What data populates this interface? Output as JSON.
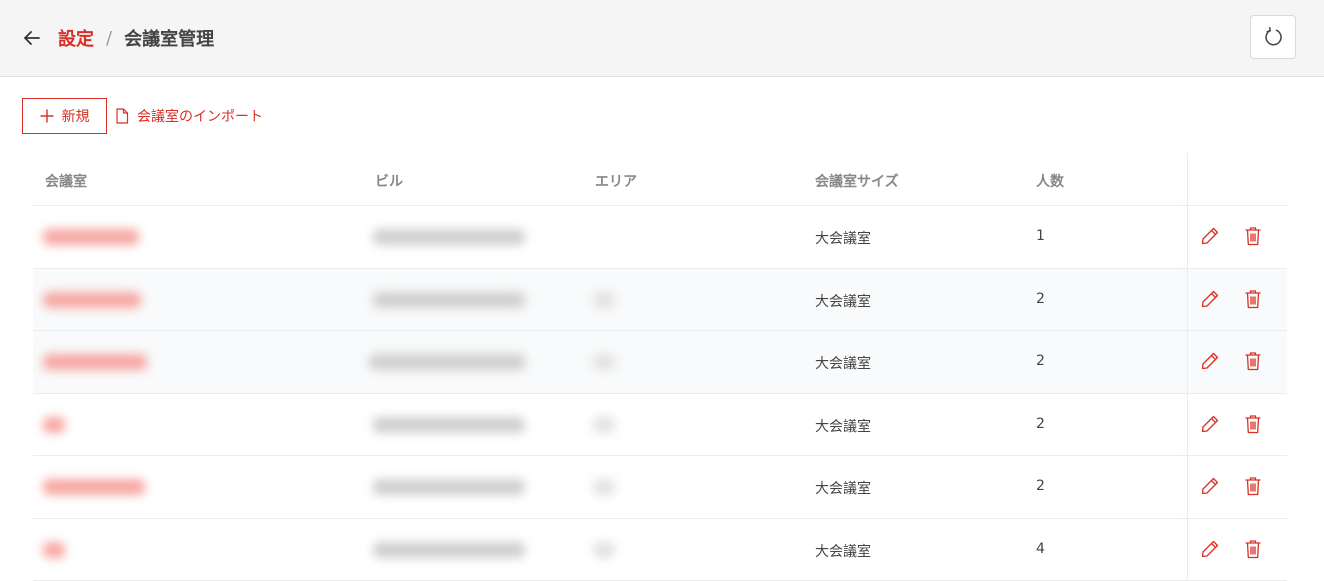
{
  "header": {
    "breadcrumb_parent": "設定",
    "breadcrumb_separator": "/",
    "breadcrumb_current": "会議室管理"
  },
  "toolbar": {
    "new_label": "新規",
    "import_label": "会議室のインポート"
  },
  "table": {
    "columns": [
      "会議室",
      "ビル",
      "エリア",
      "会議室サイズ",
      "人数"
    ],
    "rows": [
      {
        "size": "大会議室",
        "capacity": "1"
      },
      {
        "size": "大会議室",
        "capacity": "2"
      },
      {
        "size": "大会議室",
        "capacity": "2"
      },
      {
        "size": "大会議室",
        "capacity": "2"
      },
      {
        "size": "大会議室",
        "capacity": "2"
      },
      {
        "size": "大会議室",
        "capacity": "4"
      }
    ]
  },
  "colors": {
    "accent": "#d93025",
    "header_bg": "#f5f5f5",
    "row_alt_bg": "#f9fafb"
  },
  "icons": {
    "back": "arrow-left-icon",
    "refresh": "refresh-icon",
    "new": "plus-icon",
    "import": "file-icon",
    "edit": "pencil-icon",
    "delete": "trash-icon"
  }
}
